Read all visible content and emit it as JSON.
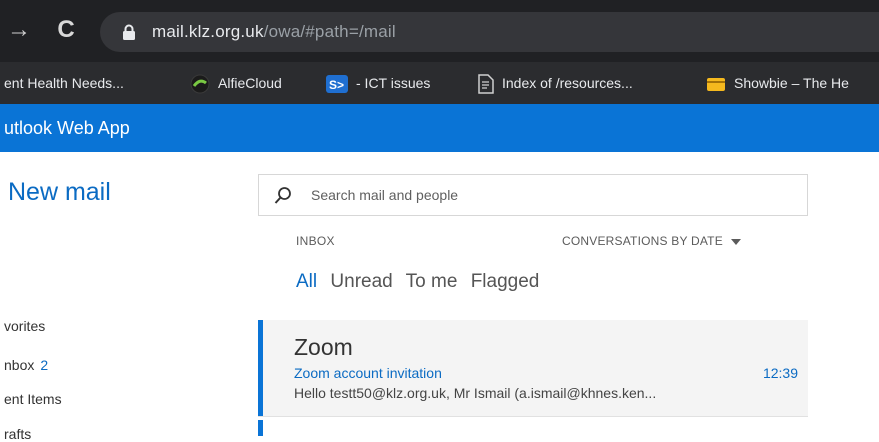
{
  "browser": {
    "url_host": "mail.klz.org.uk",
    "url_path": "/owa/#path=/mail",
    "bookmarks": [
      {
        "label": "ent Health Needs...",
        "icon": "page-icon"
      },
      {
        "label": "AlfieCloud",
        "icon": "alfiecloud-icon"
      },
      {
        "label": "- ICT issues",
        "icon": "sharepoint-icon"
      },
      {
        "label": "Index of /resources...",
        "icon": "file-icon"
      },
      {
        "label": "Showbie – The He",
        "icon": "showbie-icon"
      }
    ]
  },
  "app": {
    "title": "utlook Web App",
    "brand_color": "#0a74d6"
  },
  "nav": {
    "new_mail": "New mail",
    "folders": [
      {
        "label": "vorites"
      },
      {
        "label": "nbox",
        "count": "2"
      },
      {
        "label": "ent Items"
      },
      {
        "label": "rafts"
      }
    ]
  },
  "search": {
    "placeholder": "Search mail and people"
  },
  "list": {
    "folder_label": "INBOX",
    "sort_label": "CONVERSATIONS BY DATE",
    "filters": [
      "All",
      "Unread",
      "To me",
      "Flagged"
    ],
    "active_filter": "All"
  },
  "messages": [
    {
      "sender": "Zoom",
      "subject": "Zoom account invitation",
      "time": "12:39",
      "preview": "Hello testt50@klz.org.uk, Mr Ismail (a.ismail@khnes.ken..."
    }
  ]
}
